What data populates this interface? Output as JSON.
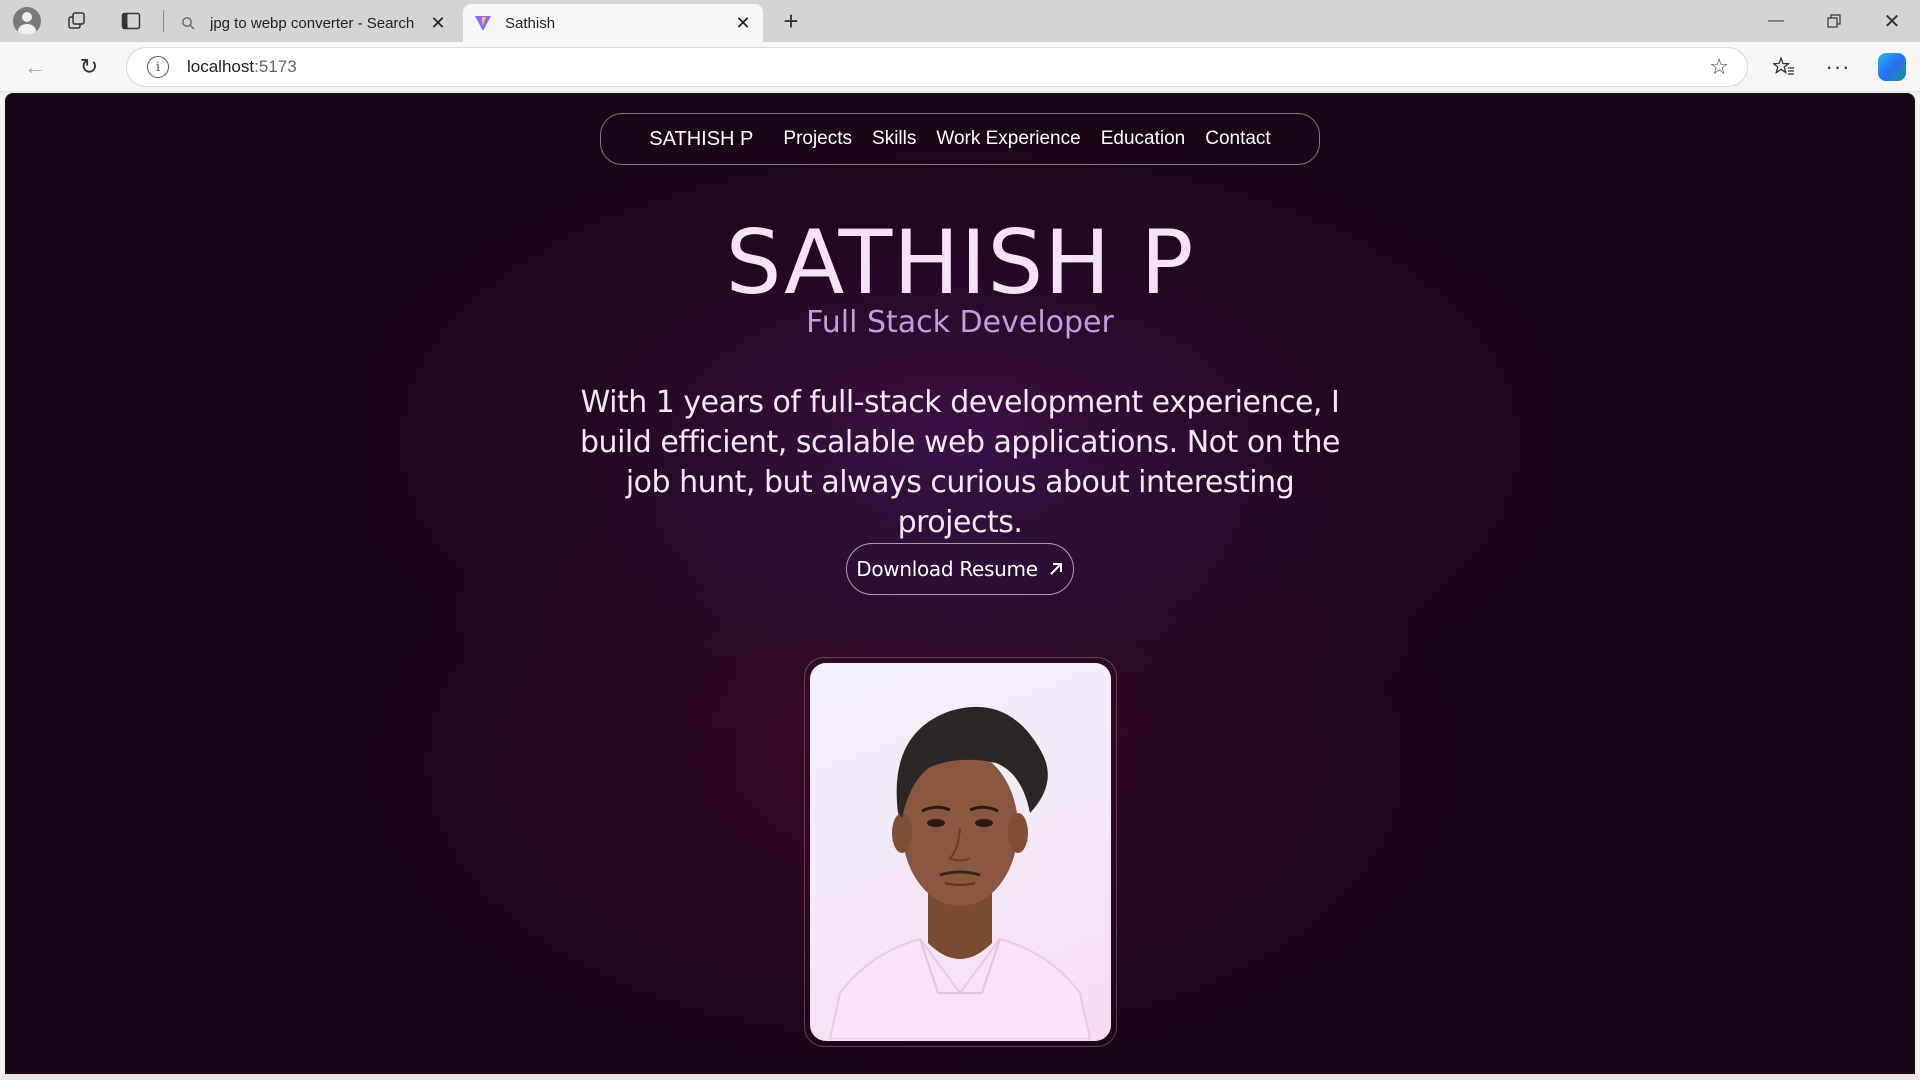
{
  "browser": {
    "tabs": [
      {
        "title": "jpg to webp converter - Search",
        "active": false,
        "favicon": "search-icon"
      },
      {
        "title": "Sathish",
        "active": true,
        "favicon": "vite-logo-icon"
      }
    ],
    "address": {
      "host": "localhost",
      "port": ":5173"
    }
  },
  "nav": {
    "brand": "SATHISH P",
    "links": [
      "Projects",
      "Skills",
      "Work Experience",
      "Education",
      "Contact"
    ]
  },
  "hero": {
    "name": "SATHISH P",
    "role": "Full Stack Developer",
    "bio": "With 1 years of full-stack development experience, I build efficient, scalable web applications. Not on the job hunt, but always curious about interesting projects.",
    "resume_button": "Download Resume"
  },
  "colors": {
    "page_bg": "#1a0715",
    "name_color": "#f6e3f5",
    "role_color": "#c79be0"
  }
}
